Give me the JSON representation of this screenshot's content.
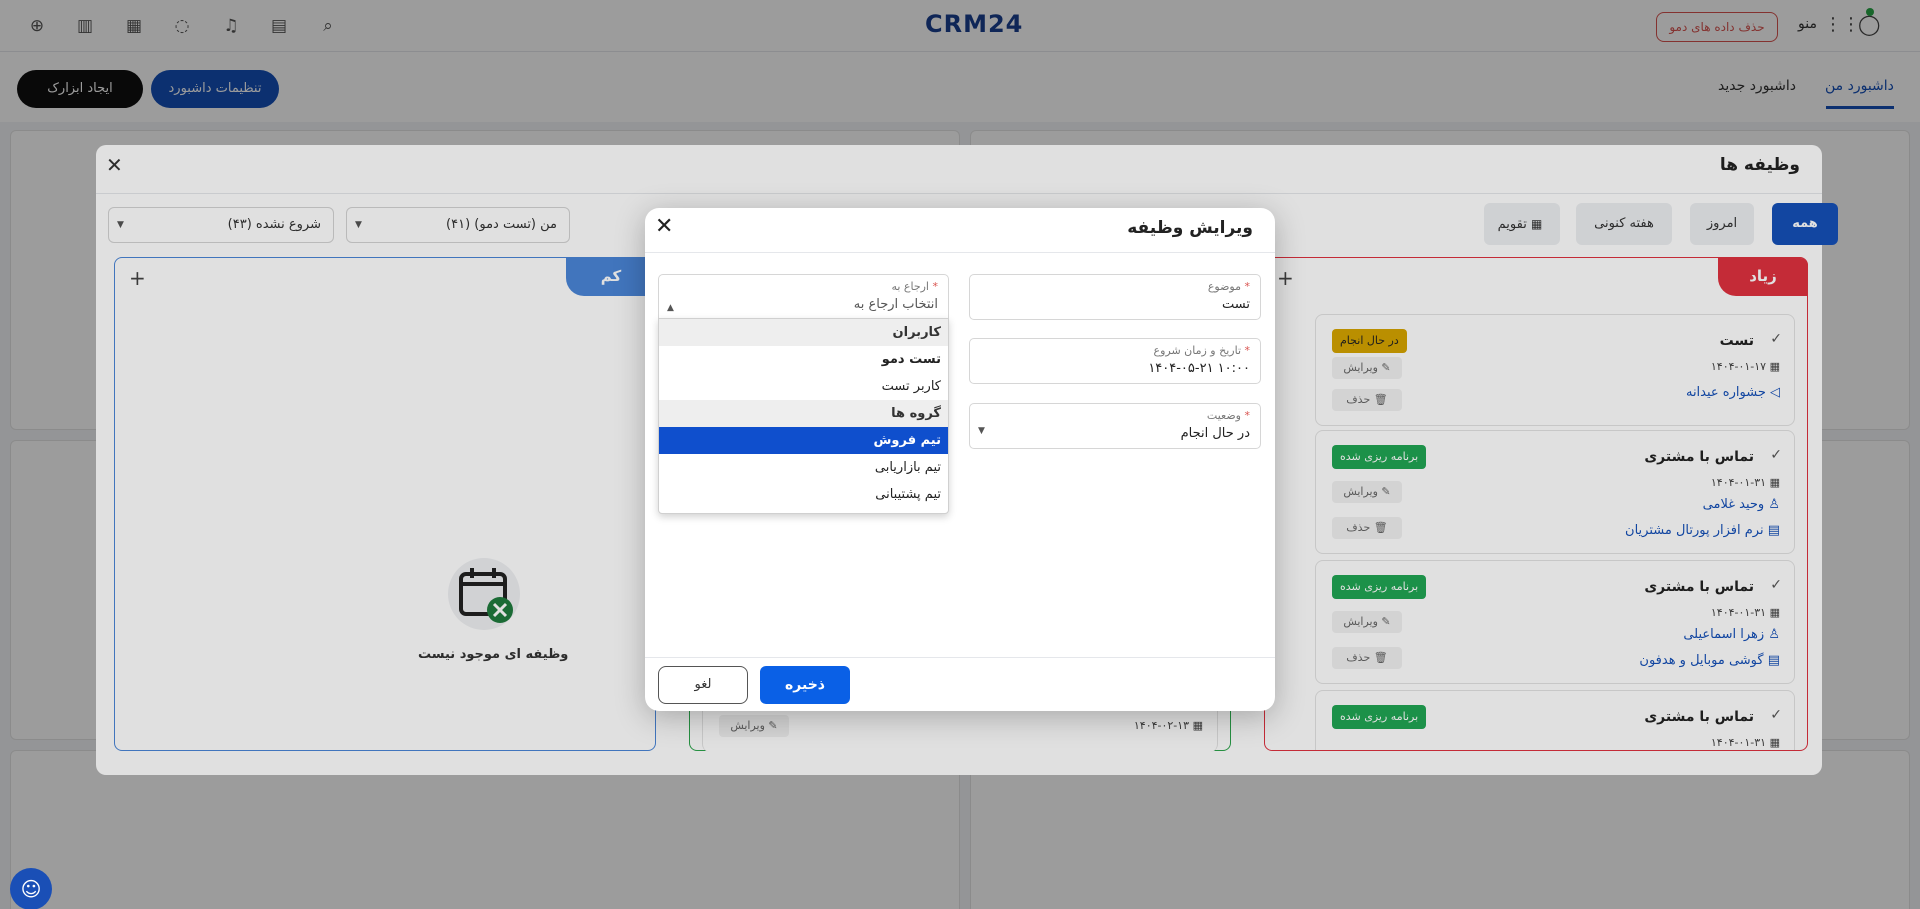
{
  "topbar": {
    "logo": "CRM24",
    "delete_demo_label": "حذف داده های دمو",
    "menu_label": "منو"
  },
  "subbar": {
    "create_widget_label": "ایجاد ابزارک",
    "dashboard_settings_label": "تنظیمات داشبورد",
    "tab_my_dashboard": "داشبورد من",
    "tab_new_dashboard": "داشبورد جدید"
  },
  "tasks_panel": {
    "title": "وظیفه ها",
    "tabs": [
      "همه",
      "امروز",
      "هفته کنونی",
      "تقویم"
    ],
    "filter_user": "من (تست دمو) (۴۱)",
    "filter_status": "شروع نشده (۴۳)",
    "columns": {
      "high": "زیاد",
      "low": "کم"
    },
    "empty_text": "وظیفه ای موجود نیست",
    "edit_label": "ویرایش",
    "delete_label": "حذف",
    "cards": [
      {
        "title": "تست",
        "badge": "در حال انجام",
        "badge_color": "#d4a300",
        "date": "۱۴۰۴-۰۱-۱۷",
        "links": [
          "جشواره عیدانه"
        ]
      },
      {
        "title": "تماس با مشتری",
        "badge": "برنامه ریزی شده",
        "badge_color": "#20a554",
        "date": "۱۴۰۴-۰۱-۳۱",
        "links": [
          "وحید غلامی",
          "نرم افزار پورتال مشتریان"
        ]
      },
      {
        "title": "تماس با مشتری",
        "badge": "برنامه ریزی شده",
        "badge_color": "#20a554",
        "date": "۱۴۰۴-۰۱-۳۱",
        "links": [
          "زهرا اسماعیلی",
          "گوشی موبایل و هدفون"
        ]
      },
      {
        "title": "تماس با مشتری",
        "badge": "برنامه ریزی شده",
        "badge_color": "#20a554",
        "date": "۱۴۰۴-۰۱-۳۱",
        "links": []
      }
    ],
    "middle_card_date": "۱۴۰۴-۰۲-۱۳"
  },
  "dialog": {
    "title": "ویرایش وظیفه",
    "subject": {
      "label": "موضوع",
      "value": "تست"
    },
    "assigned": {
      "label": "ارجاع به",
      "placeholder": "انتخاب ارجاع به"
    },
    "start": {
      "label": "تاریخ و زمان شروع",
      "value": "۱۴۰۴-۰۵-۲۱ ۱۰:۰۰"
    },
    "status": {
      "label": "وضعیت",
      "value": "در حال انجام"
    },
    "dropdown": [
      {
        "label": "کاربران",
        "kind": "group"
      },
      {
        "label": "تست دمو",
        "kind": "item"
      },
      {
        "label": "کاربر تست",
        "kind": "item"
      },
      {
        "label": "گروه ها",
        "kind": "group"
      },
      {
        "label": "تیم فروش",
        "kind": "selected"
      },
      {
        "label": "تیم بازاریابی",
        "kind": "item"
      },
      {
        "label": "تیم پشتیبانی",
        "kind": "item"
      }
    ],
    "save_label": "ذخیره",
    "cancel_label": "لغو"
  },
  "colors": {
    "primary": "#0a60e6",
    "brand_dark": "#1550b8",
    "high_priority": "#e0313f",
    "low_priority": "#4a86d8"
  }
}
